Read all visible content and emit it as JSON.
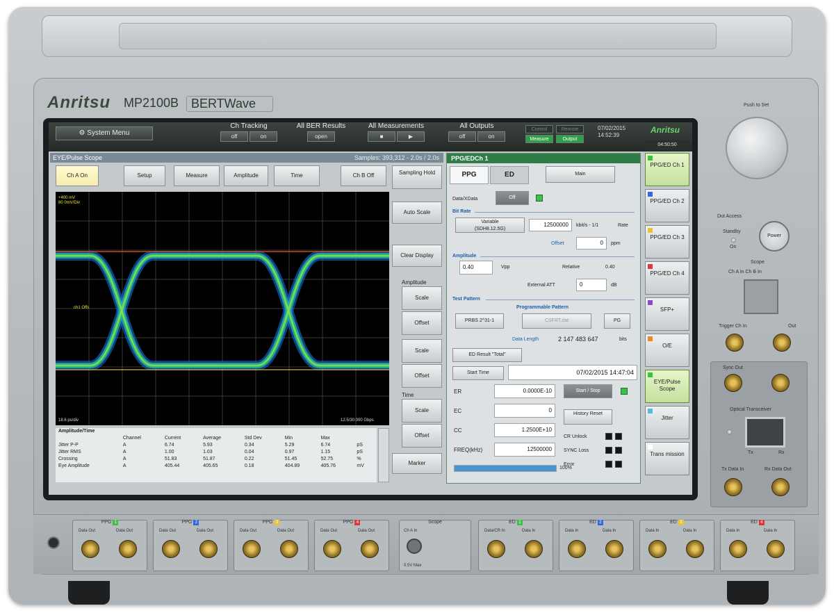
{
  "instrument": {
    "brand": "Anritsu",
    "model": "MP2100B",
    "product": "BERTWave"
  },
  "topbar": {
    "system_menu": "System Menu",
    "ch_tracking": {
      "label": "Ch Tracking",
      "off": "off",
      "on": "on"
    },
    "all_ber_results": {
      "label": "All BER Results",
      "open": "open"
    },
    "all_measurements": {
      "label": "All Measurements",
      "stop": "■",
      "start": "▶"
    },
    "all_outputs": {
      "label": "All Outputs",
      "off": "off",
      "on": "on"
    },
    "lamps": {
      "control": "Control",
      "remote": "Remote",
      "measure": "Measure",
      "output": "Output"
    },
    "date": "07/02/2015",
    "time": "14:52:39",
    "logo": "Anritsu"
  },
  "scope": {
    "title": "EYE/Pulse Scope",
    "samples": "Samples: 393,312 - 2.0s / 2.0s",
    "tabs": [
      "Ch A On",
      "Setup",
      "Measure",
      "Amplitude",
      "Time",
      "Ch B Off"
    ],
    "sampling_hold": "Sampling Hold",
    "auto_scale": "Auto Scale",
    "clear_display": "Clear Display",
    "amplitude_label": "Amplitude",
    "scale": "Scale",
    "offset": "Offset",
    "time_label": "Time",
    "marker": "Marker",
    "plot_info_tl": "+400 mV\n80 0mV/Div",
    "plot_info_bl": "18.6 ps/div",
    "plot_info_br": "12.5/30.000 Gbps",
    "ref_label": "ch1 Offs",
    "measurement_title": "Amplitude/Time",
    "columns": [
      "",
      "Channel",
      "Current",
      "Average",
      "Std Dev",
      "Min",
      "Max",
      ""
    ],
    "rows": [
      [
        "Jitter P-P",
        "A",
        "6.74",
        "5.93",
        "0.34",
        "5.29",
        "6.74",
        "pS"
      ],
      [
        "Jitter RMS",
        "A",
        "1.00",
        "1.03",
        "0.04",
        "0.97",
        "1.15",
        "pS"
      ],
      [
        "Crossing",
        "A",
        "51.83",
        "51.87",
        "0.22",
        "51.45",
        "52.75",
        "%"
      ],
      [
        "Eye Amplitude",
        "A",
        "405.44",
        "405.65",
        "0.18",
        "404.89",
        "405.76",
        "mV"
      ]
    ]
  },
  "ppg": {
    "title": "PPG/EDCh 1",
    "tab_ppg": "PPG",
    "tab_ed": "ED",
    "main": "Main",
    "data_xdata": "Data/XData",
    "data_xdata_btn": "Off",
    "bit_rate": "Bit Rate",
    "variable": "Variable",
    "variable_sub": "(SDH8.12.5G)",
    "rate_value": "12500000",
    "rate_unit": "kbit/s - 1/1",
    "rate": "Rate",
    "offset_label": "Offset",
    "offset_value": "0",
    "ppm": "ppm",
    "amplitude": "Amplitude",
    "amp_value": "0.40",
    "vpp": "Vpp",
    "relative": "Relative",
    "relative_value": "0.40",
    "external_att": "External ATT",
    "ext_value": "0",
    "db": "dB",
    "test_pattern": "Test Pattern",
    "programmable": "Programmable Pattern",
    "prbs": "PRBS 2^31-1",
    "file": "CSFRT.dat",
    "pg": "PG",
    "data_length_label": "Data Length",
    "data_length_value": "2 147 483 647",
    "bits": "bits",
    "ed_result": "ED Result \"Total\"",
    "start_time": "Start Time",
    "start_time_value": "07/02/2015 14:47:04",
    "er": "ER",
    "er_value": "0.0000E-10",
    "ec": "EC",
    "ec_value": "0",
    "cc": "CC",
    "cc_value": "1.2500E+10",
    "freq": "FREQ(kHz)",
    "freq_value": "12500000",
    "start_stop": "Start / Stop",
    "history_reset": "History Reset",
    "cr_unlock": "CR Unlock",
    "sync_loss": "SYNC Loss",
    "error": "Error",
    "progress": 1.0,
    "progress_label": "100%"
  },
  "chnav": {
    "time": "04:50:50",
    "items": [
      {
        "label": "PPG/ED Ch 1",
        "color": "#3cc04a"
      },
      {
        "label": "PPG/ED Ch 2",
        "color": "#3a66d8"
      },
      {
        "label": "PPG/ED Ch 3",
        "color": "#e8c23a"
      },
      {
        "label": "PPG/ED Ch 4",
        "color": "#d83a3a"
      },
      {
        "label": "SFP+",
        "color": "#8a4ac0"
      },
      {
        "label": "O/E",
        "color": "#e88a2a"
      },
      {
        "label": "EYE/Pulse Scope",
        "color": "#3cc04a"
      },
      {
        "label": "Jitter",
        "color": "#5ab8d8"
      },
      {
        "label": "Trans mission",
        "color": "#ffffff"
      }
    ]
  },
  "hardware": {
    "push_to_set": "Push to Set",
    "dut_access": "Dut Access",
    "standby": "Standby",
    "on": "On",
    "power": "Power",
    "scope": "Scope",
    "ch_a_in": "Ch A In   Ch B In",
    "sync_out": "Sync Out",
    "optical_transceiver": "Optical Transceiver",
    "tx": "Tx",
    "rx": "Rx",
    "tx_data_in": "Tx Data In",
    "rx_data_out": "Rx Data Out",
    "trigger_ch_in": "Trigger Ch In",
    "out": "Out"
  },
  "modules": [
    {
      "label": "PPG",
      "num": "1",
      "color": "#3cc04a",
      "a": "Data Out",
      "b": "Data Out"
    },
    {
      "label": "PPG",
      "num": "2",
      "color": "#3a66d8",
      "a": "Data Out",
      "b": "Data Out"
    },
    {
      "label": "PPG",
      "num": "3",
      "color": "#e8c23a",
      "a": "Data Out",
      "b": "Data Out"
    },
    {
      "label": "PPG",
      "num": "4",
      "color": "#d83a3a",
      "a": "Data Out",
      "b": "Data Out"
    },
    {
      "label": "ED",
      "num": "1",
      "color": "#3cc04a",
      "a": "Data/CR In",
      "b": "Data In"
    },
    {
      "label": "ED",
      "num": "2",
      "color": "#3a66d8",
      "a": "Data In",
      "b": "Data In"
    },
    {
      "label": "ED",
      "num": "3",
      "color": "#e8c23a",
      "a": "Data In",
      "b": "Data In"
    },
    {
      "label": "ED",
      "num": "4",
      "color": "#d83a3a",
      "a": "Data In",
      "b": "Data In"
    }
  ],
  "bottom_scope": {
    "label": "Scope",
    "ch_a_in": "Ch A In",
    "max": "0.5V Max"
  }
}
